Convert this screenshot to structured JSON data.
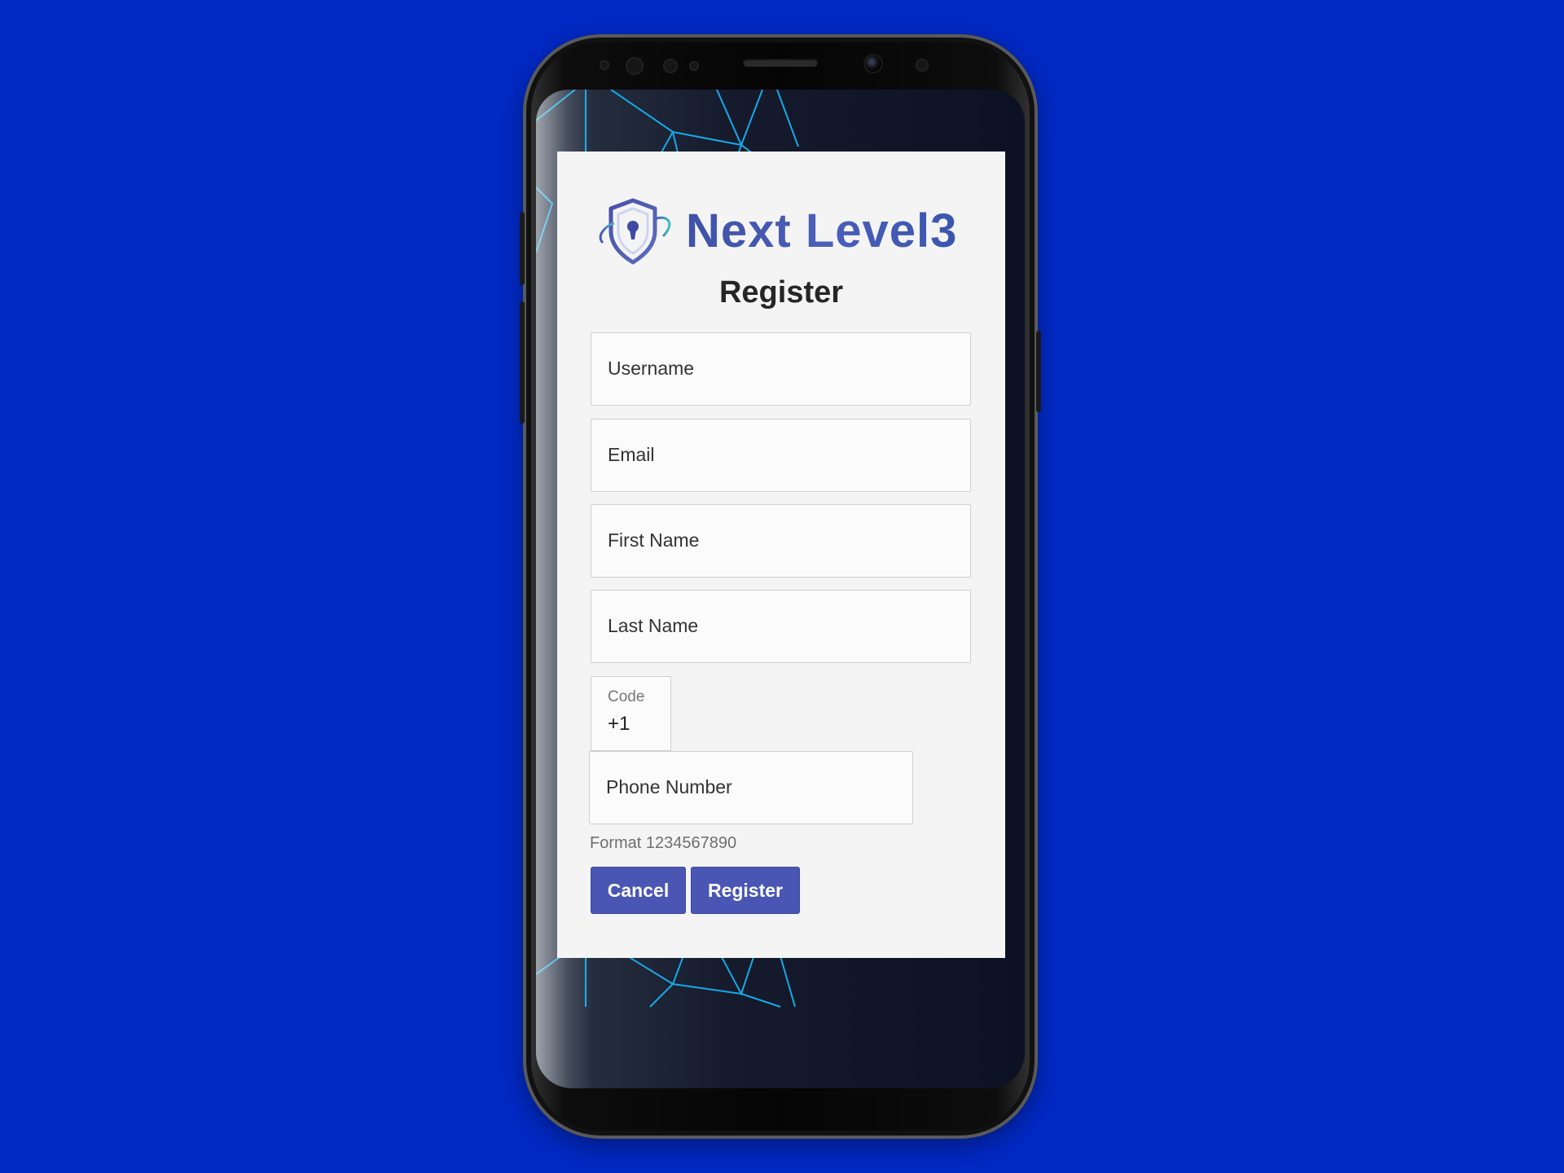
{
  "app": {
    "brand_name": "Next Level3",
    "brand_color": "#4a5fb8"
  },
  "form": {
    "title": "Register",
    "fields": {
      "username": {
        "placeholder": "Username"
      },
      "email": {
        "placeholder": "Email"
      },
      "first_name": {
        "placeholder": "First Name"
      },
      "last_name": {
        "placeholder": "Last Name"
      },
      "country_code": {
        "label": "Code",
        "value": "+1"
      },
      "phone": {
        "placeholder": "Phone Number",
        "hint": "Format 1234567890"
      }
    },
    "buttons": {
      "cancel": "Cancel",
      "register": "Register"
    },
    "button_color": "#4a56b4"
  },
  "icons": {
    "logo": "shield-lock-icon"
  },
  "colors": {
    "background": "#0029c4",
    "network_lines": "#19a8e8"
  }
}
